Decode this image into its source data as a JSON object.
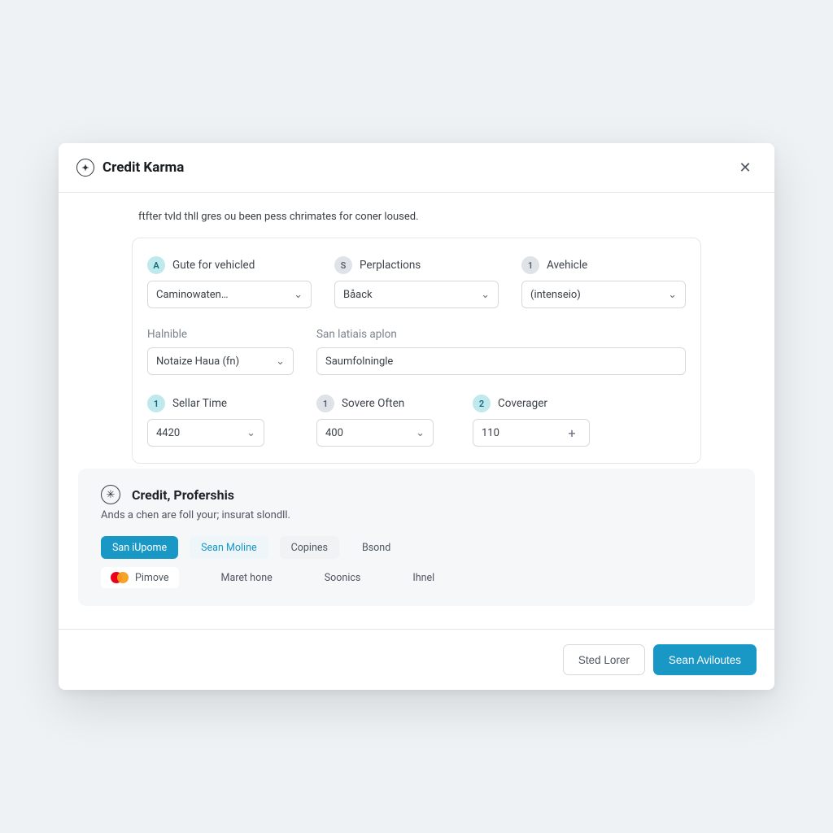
{
  "header": {
    "brand": "Credit Karma",
    "logo_glyph": "✦"
  },
  "intro": "ftfter tvld thll gres ou been pess chrimates for coner loused.",
  "form": {
    "row1": {
      "guide": {
        "badge": "A",
        "label": "Gute for vehicled",
        "value": "Caminowaten…"
      },
      "percep": {
        "badge": "S",
        "label": "Perplactions",
        "value": "Båack"
      },
      "vehicle": {
        "badge": "1",
        "label": "Avehicle",
        "value": "(intenseio)"
      }
    },
    "row2": {
      "halnible": {
        "label": "Halnible",
        "value": "Notaize Haua (fn)"
      },
      "san_aplon": {
        "label": "San latiais aplon",
        "value": "Saumfolningle"
      }
    },
    "row3": {
      "sellar": {
        "badge": "1",
        "label": "Sellar Time",
        "value": "4420"
      },
      "sovere": {
        "badge": "1",
        "label": "Sovere Often",
        "value": "400"
      },
      "coverage": {
        "badge": "2",
        "label": "Coverager",
        "value": "110"
      }
    }
  },
  "promo": {
    "logo_glyph": "✳",
    "title": "Credit, Profershis",
    "sub": "Ands a chen are foll your; insurat slondll.",
    "chips": [
      "San iUpome",
      "Sean Moline",
      "Copines",
      "Bsond"
    ],
    "providers": [
      "Pimove",
      "Maret hone",
      "Soonics",
      "Ihnel"
    ]
  },
  "footer": {
    "secondary": "Sted Lorer",
    "primary": "Sean Aviloutes"
  }
}
